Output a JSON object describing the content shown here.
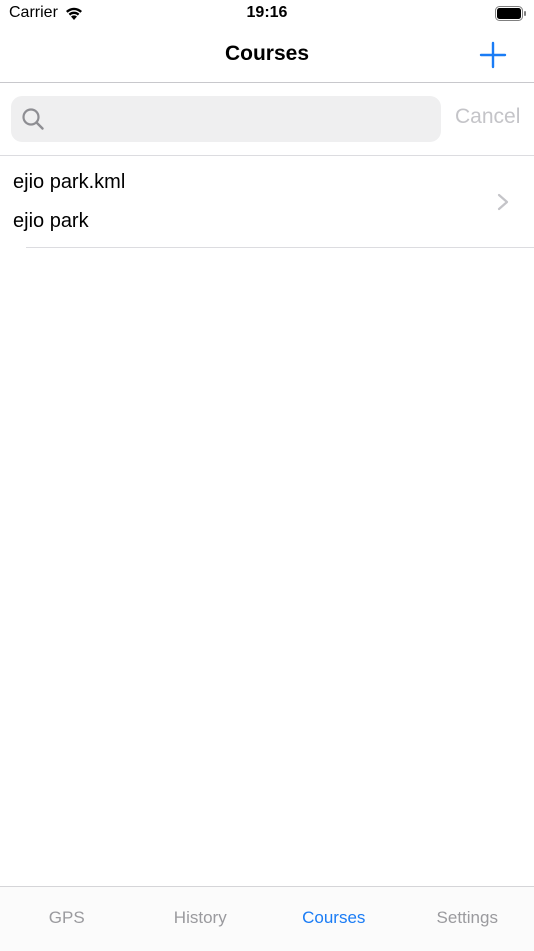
{
  "status_bar": {
    "carrier": "Carrier",
    "time": "19:16"
  },
  "nav_bar": {
    "title": "Courses",
    "add_icon": "plus-icon"
  },
  "search": {
    "value": "",
    "placeholder": "",
    "cancel_label": "Cancel"
  },
  "courses": [
    {
      "filename": "ejio park.kml",
      "name": "ejio park"
    }
  ],
  "tabs": [
    {
      "label": "GPS",
      "active": false
    },
    {
      "label": "History",
      "active": false
    },
    {
      "label": "Courses",
      "active": true
    },
    {
      "label": "Settings",
      "active": false
    }
  ],
  "colors": {
    "accent": "#1a7cf5",
    "inactive_tab": "#9a9a9e",
    "disabled_text": "#c4c4c8"
  }
}
